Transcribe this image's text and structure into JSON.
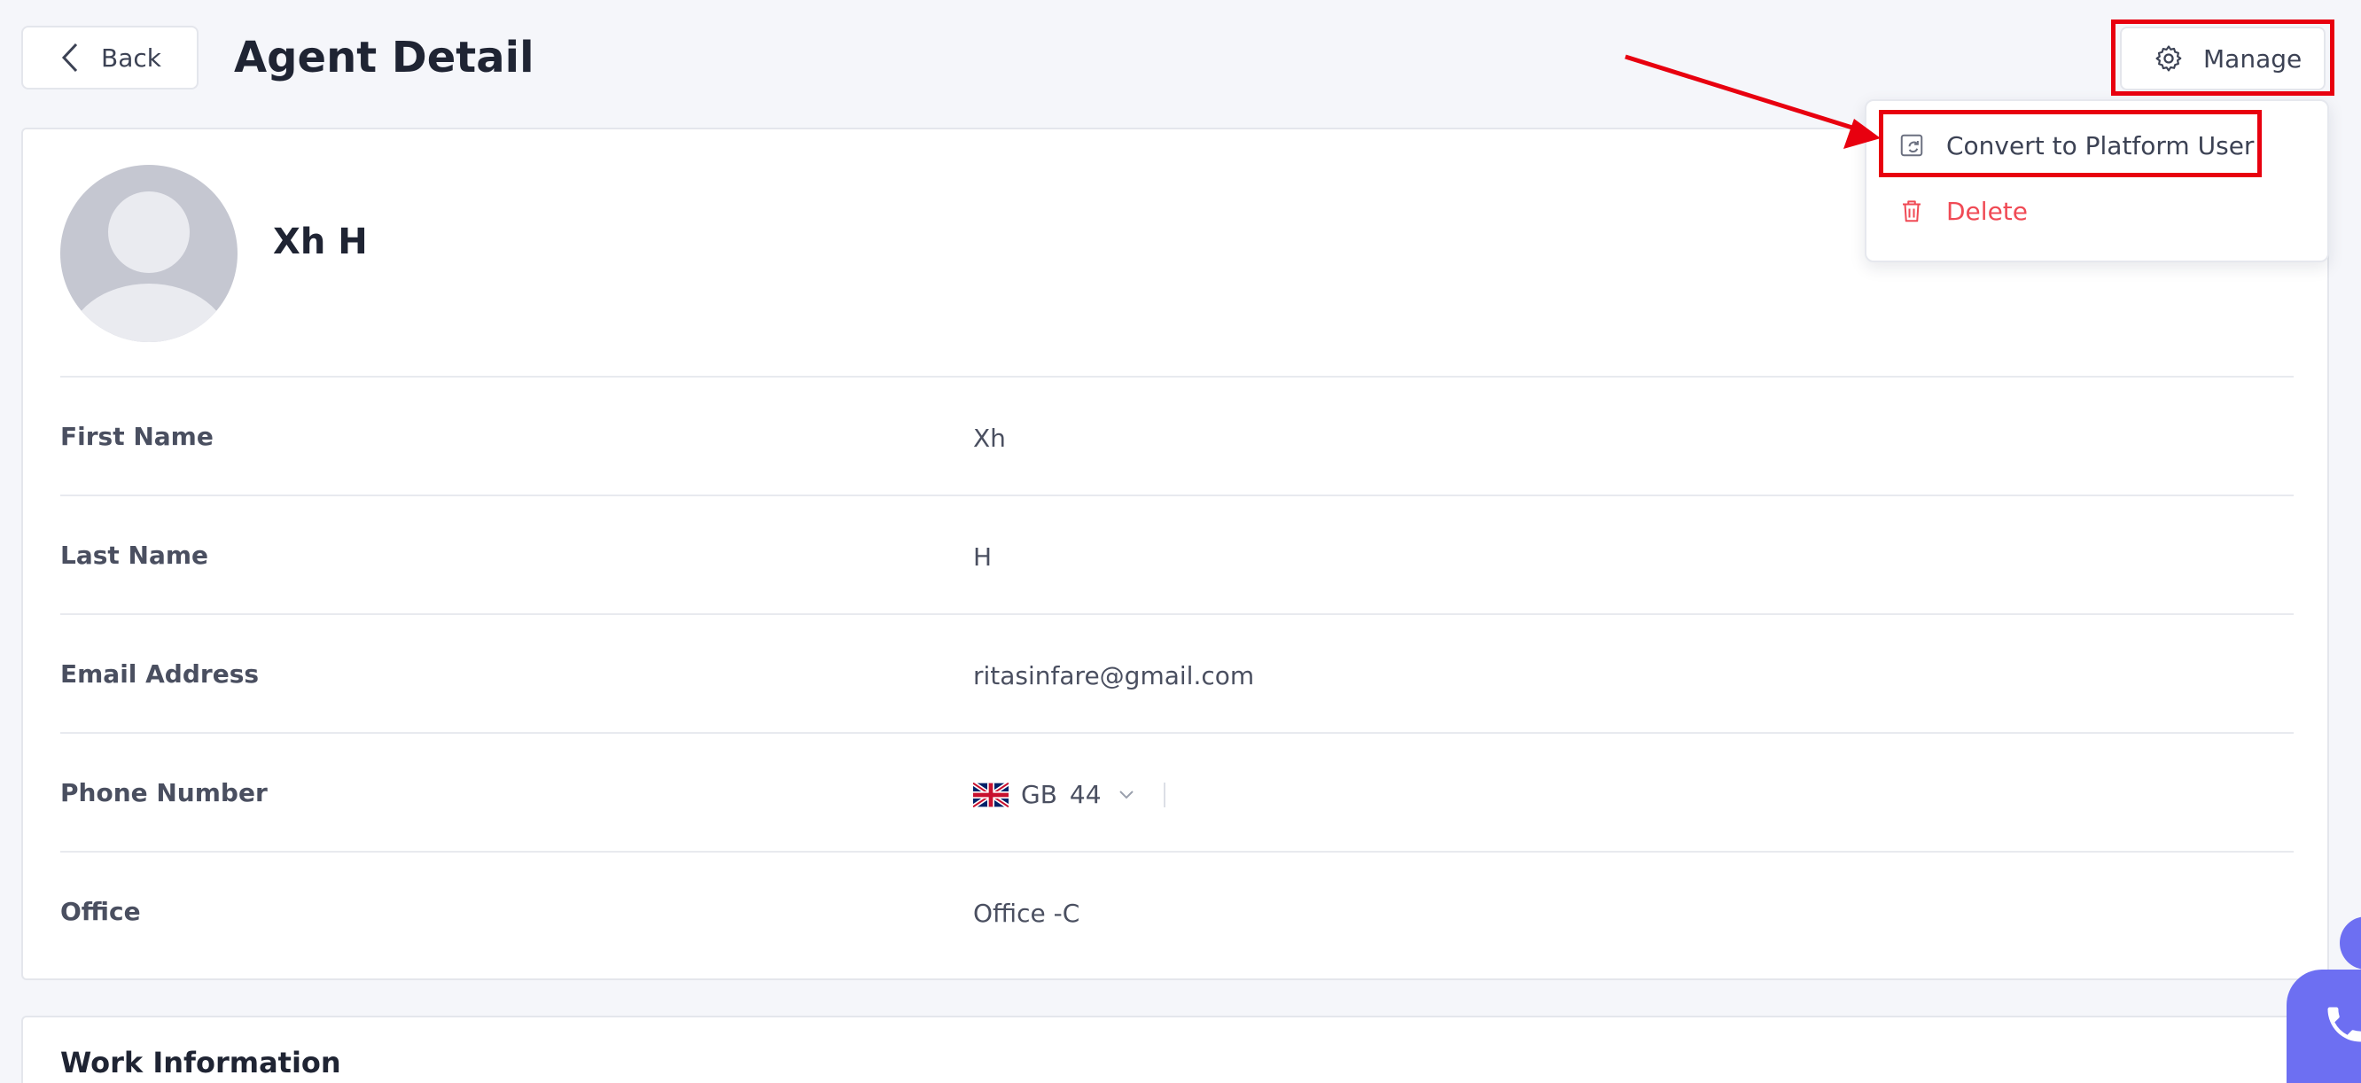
{
  "header": {
    "back_label": "Back",
    "title": "Agent Detail",
    "manage_label": "Manage"
  },
  "menu": {
    "convert_label": "Convert to Platform User",
    "delete_label": "Delete"
  },
  "agent": {
    "name": "Xh H"
  },
  "fields": [
    {
      "label": "First Name",
      "value": "Xh"
    },
    {
      "label": "Last Name",
      "value": "H"
    },
    {
      "label": "Email Address",
      "value": "ritasinfare@gmail.com"
    },
    {
      "label": "Phone Number",
      "country_code": "GB",
      "dial_code": "44"
    },
    {
      "label": "Office",
      "value": "Office -C"
    }
  ],
  "work_info": {
    "title": "Work Information"
  },
  "colors": {
    "accent": "#6d6ff2",
    "danger": "#f04a55",
    "highlight": "#e8000f"
  },
  "icons": [
    "chevron-left-icon",
    "gear-icon",
    "convert-user-icon",
    "trash-icon",
    "uk-flag-icon",
    "chevron-down-icon",
    "phone-icon"
  ]
}
